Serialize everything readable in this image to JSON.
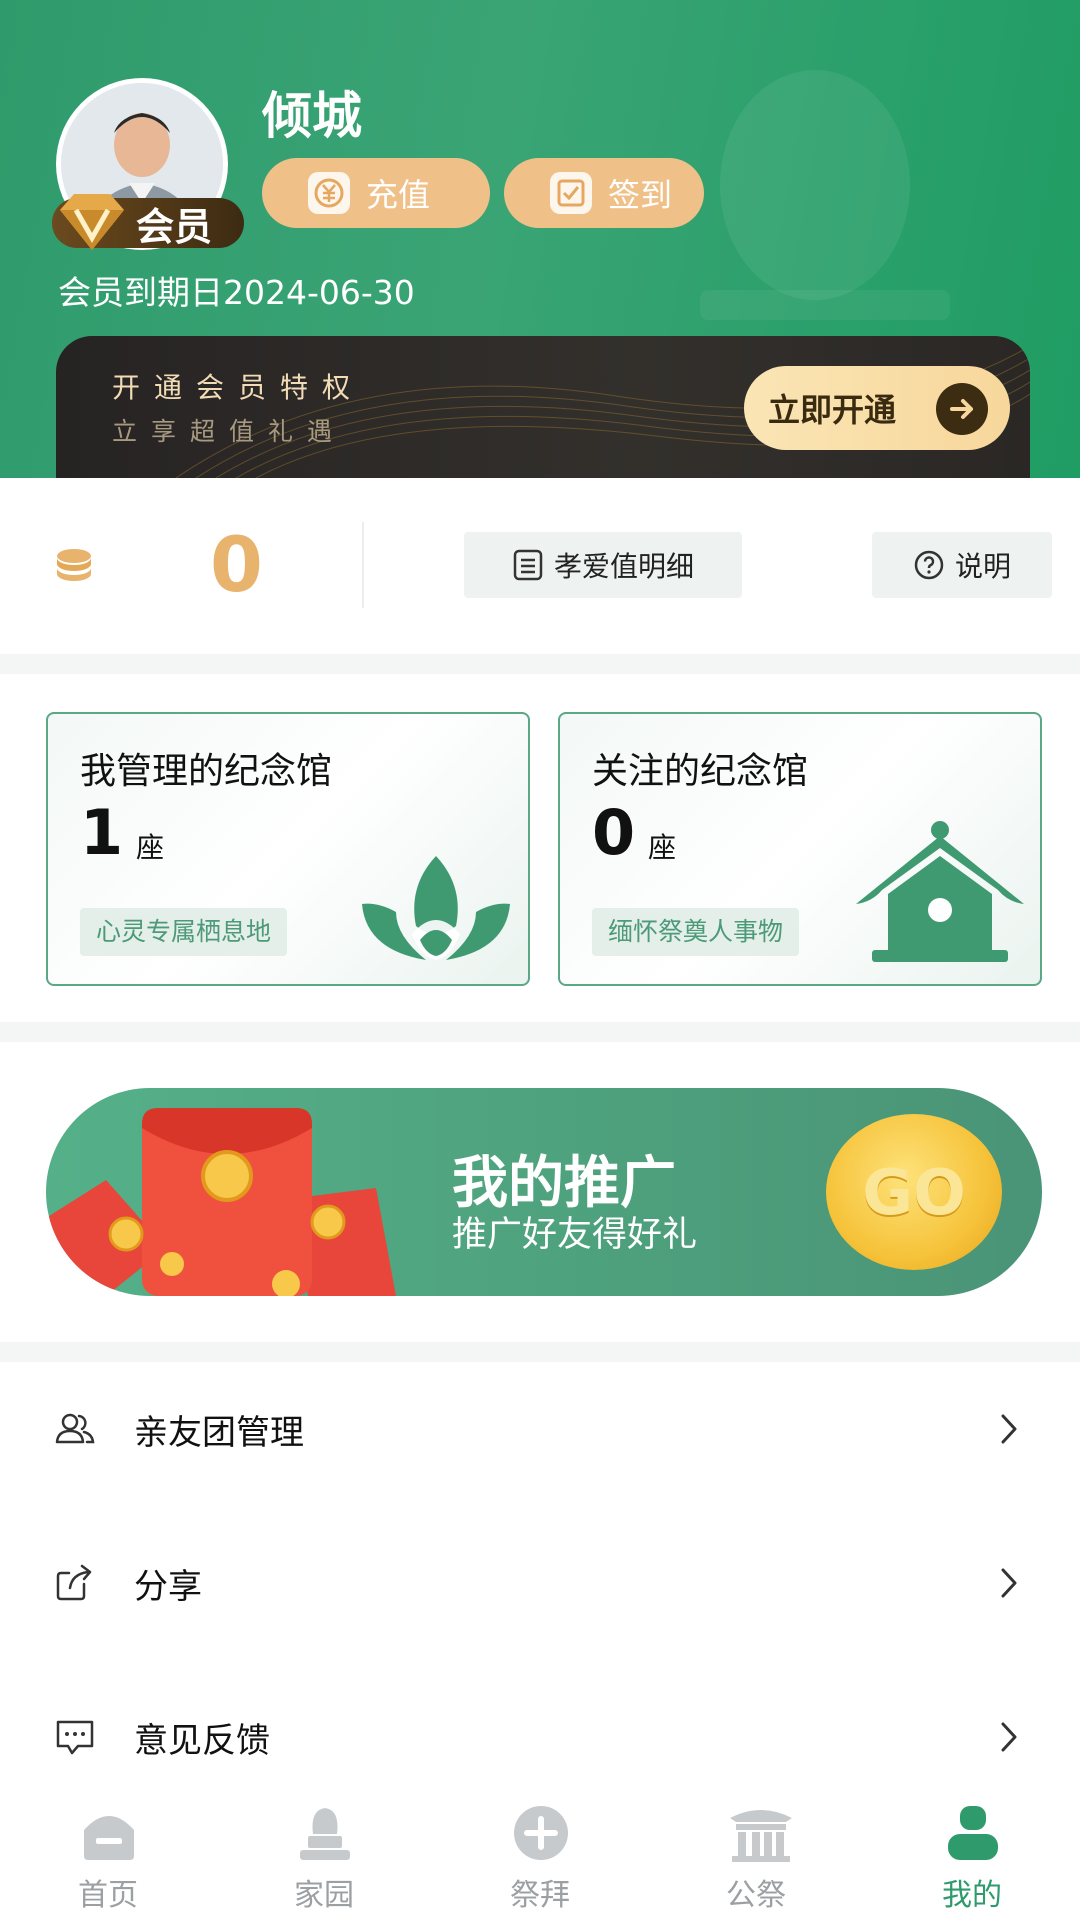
{
  "profile": {
    "username": "倾城",
    "vip_badge": "会员",
    "expire_text": "会员到期日2024-06-30",
    "recharge_label": "充值",
    "checkin_label": "签到"
  },
  "vip_banner": {
    "title": "开通会员特权",
    "subtitle": "立享超值礼遇",
    "open_label": "立即开通"
  },
  "points": {
    "value": "0",
    "detail_label": "孝爱值明细",
    "help_label": "说明"
  },
  "cards": [
    {
      "title": "我管理的纪念馆",
      "count": "1",
      "unit": "座",
      "tag": "心灵专属栖息地"
    },
    {
      "title": "关注的纪念馆",
      "count": "0",
      "unit": "座",
      "tag": "缅怀祭奠人事物"
    }
  ],
  "promo": {
    "title": "我的推广",
    "subtitle": "推广好友得好礼",
    "go_label": "GO"
  },
  "menu": [
    {
      "label": "亲友团管理",
      "icon": "group-icon"
    },
    {
      "label": "分享",
      "icon": "share-icon"
    },
    {
      "label": "意见反馈",
      "icon": "feedback-icon"
    }
  ],
  "nav": [
    {
      "label": "首页",
      "icon": "home-icon"
    },
    {
      "label": "家园",
      "icon": "tomb-icon"
    },
    {
      "label": "祭拜",
      "icon": "plus-circle-icon"
    },
    {
      "label": "公祭",
      "icon": "temple-icon"
    },
    {
      "label": "我的",
      "icon": "person-icon",
      "active": true
    }
  ],
  "colors": {
    "primary_green": "#2f9b6c",
    "gold": "#e8b36d",
    "nav_inactive": "#9ca0a3"
  }
}
